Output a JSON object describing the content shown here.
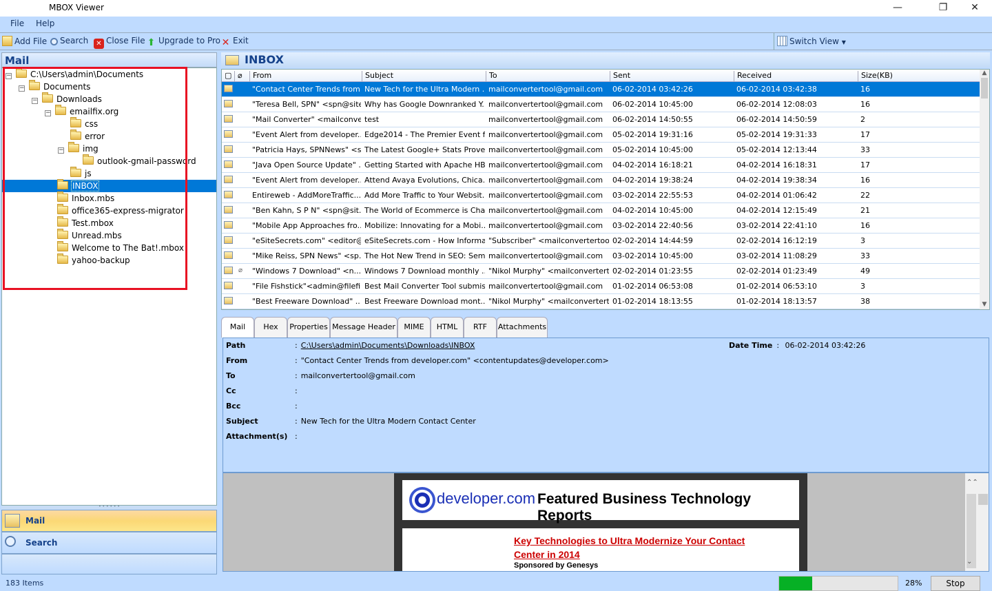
{
  "app": {
    "title": "MBOX Viewer"
  },
  "window_controls": {
    "minimize": "—",
    "maximize": "❐",
    "close": "✕"
  },
  "menu": [
    "File",
    "Help"
  ],
  "toolbar": {
    "add_file": "Add File",
    "search": "Search",
    "close_file": "Close File",
    "upgrade": "Upgrade to Pro",
    "exit": "Exit",
    "switch_view": "Switch View"
  },
  "left_pane": {
    "header": "Mail",
    "tree": [
      {
        "label": "C:\\Users\\admin\\Documents",
        "level": 0,
        "expanded": true
      },
      {
        "label": "Documents",
        "level": 1,
        "expanded": true
      },
      {
        "label": "Downloads",
        "level": 2,
        "expanded": true
      },
      {
        "label": "emailfix.org",
        "level": 3,
        "expanded": true
      },
      {
        "label": "css",
        "level": 4
      },
      {
        "label": "error",
        "level": 4
      },
      {
        "label": "img",
        "level": 4,
        "expanded": true
      },
      {
        "label": "outlook-gmail-password",
        "level": 5
      },
      {
        "label": "js",
        "level": 4
      },
      {
        "label": "INBOX",
        "level": 3,
        "selected": true
      },
      {
        "label": "Inbox.mbs",
        "level": 3
      },
      {
        "label": "office365-express-migrator",
        "level": 3
      },
      {
        "label": "Test.mbox",
        "level": 3
      },
      {
        "label": "Unread.mbs",
        "level": 3
      },
      {
        "label": "Welcome to The Bat!.mbox",
        "level": 3
      },
      {
        "label": "yahoo-backup",
        "level": 3
      }
    ],
    "nav": {
      "mail": "Mail",
      "search": "Search"
    }
  },
  "inbox": {
    "title": "INBOX",
    "columns": [
      "From",
      "Subject",
      "To",
      "Sent",
      "Received",
      "Size(KB)"
    ],
    "rows": [
      {
        "from": "\"Contact Center Trends from ...",
        "subject": "New Tech for the Ultra Modern ...",
        "to": "mailconvertertool@gmail.com",
        "sent": "06-02-2014 03:42:26",
        "received": "06-02-2014 03:42:38",
        "size": "16",
        "attach": false,
        "selected": true
      },
      {
        "from": "\"Teresa Bell, SPN\" <spn@site...",
        "subject": "Why has Google Downranked Y...",
        "to": "mailconvertertool@gmail.com",
        "sent": "06-02-2014 10:45:00",
        "received": "06-02-2014 12:08:03",
        "size": "16",
        "attach": false
      },
      {
        "from": "\"Mail Converter\" <mailconve...",
        "subject": "test",
        "to": "mailconvertertool@gmail.com",
        "sent": "06-02-2014 14:50:55",
        "received": "06-02-2014 14:50:59",
        "size": "2",
        "attach": false
      },
      {
        "from": "\"Event Alert from developer....",
        "subject": "Edge2014 - The Premier Event fo...",
        "to": "mailconvertertool@gmail.com",
        "sent": "05-02-2014 19:31:16",
        "received": "05-02-2014 19:31:33",
        "size": "17",
        "attach": false
      },
      {
        "from": "\"Patricia Hays, SPNNews\" <s...",
        "subject": "The Latest Google+ Stats Prove ...",
        "to": "mailconvertertool@gmail.com",
        "sent": "05-02-2014 10:45:00",
        "received": "05-02-2014 12:13:44",
        "size": "33",
        "attach": false
      },
      {
        "from": "\"Java Open Source Update\" ...",
        "subject": "Getting Started with Apache HB...",
        "to": "mailconvertertool@gmail.com",
        "sent": "04-02-2014 16:18:21",
        "received": "04-02-2014 16:18:31",
        "size": "17",
        "attach": false
      },
      {
        "from": "\"Event Alert from developer....",
        "subject": "Attend Avaya Evolutions, Chica...",
        "to": "mailconvertertool@gmail.com",
        "sent": "04-02-2014 19:38:24",
        "received": "04-02-2014 19:38:34",
        "size": "16",
        "attach": false
      },
      {
        "from": "Entireweb - AddMoreTraffic...",
        "subject": "Add More Traffic to Your Websit...",
        "to": "mailconvertertool@gmail.com",
        "sent": "03-02-2014 22:55:53",
        "received": "04-02-2014 01:06:42",
        "size": "22",
        "attach": false
      },
      {
        "from": "\"Ben Kahn, S P N\" <spn@sit...",
        "subject": "The World of Ecommerce is Cha...",
        "to": "mailconvertertool@gmail.com",
        "sent": "04-02-2014 10:45:00",
        "received": "04-02-2014 12:15:49",
        "size": "21",
        "attach": false
      },
      {
        "from": "\"Mobile App Approaches fro...",
        "subject": "Mobilize: Innovating for a Mobi...",
        "to": "mailconvertertool@gmail.com",
        "sent": "03-02-2014 22:40:56",
        "received": "03-02-2014 22:41:10",
        "size": "16",
        "attach": false
      },
      {
        "from": "\"eSiteSecrets.com\" <editor@...",
        "subject": "eSiteSecrets.com - How Informa...",
        "to": "\"Subscriber\" <mailconvertertool...",
        "sent": "02-02-2014 14:44:59",
        "received": "02-02-2014 16:12:19",
        "size": "3",
        "attach": false
      },
      {
        "from": "\"Mike Reiss, SPN News\" <sp...",
        "subject": "The Hot New Trend in SEO: Sem...",
        "to": "mailconvertertool@gmail.com",
        "sent": "03-02-2014 10:45:00",
        "received": "03-02-2014 11:08:29",
        "size": "33",
        "attach": false
      },
      {
        "from": "\"Windows 7 Download\" <n...",
        "subject": "Windows 7 Download monthly ...",
        "to": "\"Nikol Murphy\" <mailconvertert...",
        "sent": "02-02-2014 01:23:55",
        "received": "02-02-2014 01:23:49",
        "size": "49",
        "attach": true
      },
      {
        "from": "\"File Fishstick\"<admin@filefi...",
        "subject": "Best Mail Converter Tool submis...",
        "to": "mailconvertertool@gmail.com",
        "sent": "01-02-2014 06:53:08",
        "received": "01-02-2014 06:53:10",
        "size": "3",
        "attach": false
      },
      {
        "from": "\"Best Freeware Download\" ...",
        "subject": "Best Freeware Download mont...",
        "to": "\"Nikol Murphy\" <mailconvertert...",
        "sent": "01-02-2014 18:13:55",
        "received": "01-02-2014 18:13:57",
        "size": "38",
        "attach": false
      }
    ]
  },
  "tabs": [
    "Mail",
    "Hex",
    "Properties",
    "Message Header",
    "MIME",
    "HTML",
    "RTF",
    "Attachments"
  ],
  "details": {
    "path_label": "Path",
    "path": "C:\\Users\\admin\\Documents\\Downloads\\INBOX",
    "datetime_label": "Date Time",
    "datetime": "06-02-2014 03:42:26",
    "from_label": "From",
    "from": "\"Contact Center Trends from developer.com\" <contentupdates@developer.com>",
    "to_label": "To",
    "to": "mailconvertertool@gmail.com",
    "cc_label": "Cc",
    "cc": "",
    "bcc_label": "Bcc",
    "bcc": "",
    "subject_label": "Subject",
    "subject": "New Tech for the Ultra Modern Contact Center",
    "attachments_label": "Attachment(s)",
    "attachments": ""
  },
  "preview": {
    "logo_text": "developer.com",
    "banner_title": "Featured Business Technology Reports",
    "link": "Key Technologies to Ultra Modernize Your Contact Center in 2014",
    "sponsor": "Sponsored by Genesys"
  },
  "status": {
    "items": "183 Items",
    "progress_percent": 28,
    "progress_label": "28%",
    "stop": "Stop"
  }
}
